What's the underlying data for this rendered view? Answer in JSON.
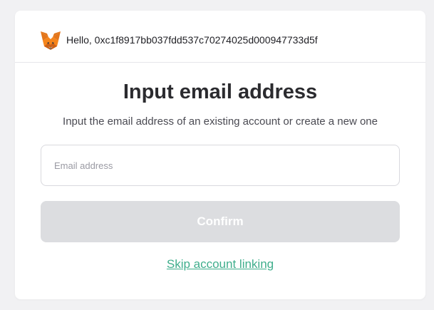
{
  "header": {
    "greeting": "Hello, 0xc1f8917bb037fdd537c70274025d000947733d5f",
    "wallet_icon": "metamask-fox-icon"
  },
  "main": {
    "title": "Input email address",
    "subtitle": "Input the email address of an existing account or create a new one",
    "email_input": {
      "placeholder": "Email address",
      "value": ""
    },
    "confirm_label": "Confirm",
    "skip_label": "Skip account linking"
  },
  "colors": {
    "page_background": "#f1f1f3",
    "card_background": "#ffffff",
    "confirm_disabled": "#dcdde0",
    "link": "#3fae8c",
    "title_text": "#2b2b2f"
  }
}
